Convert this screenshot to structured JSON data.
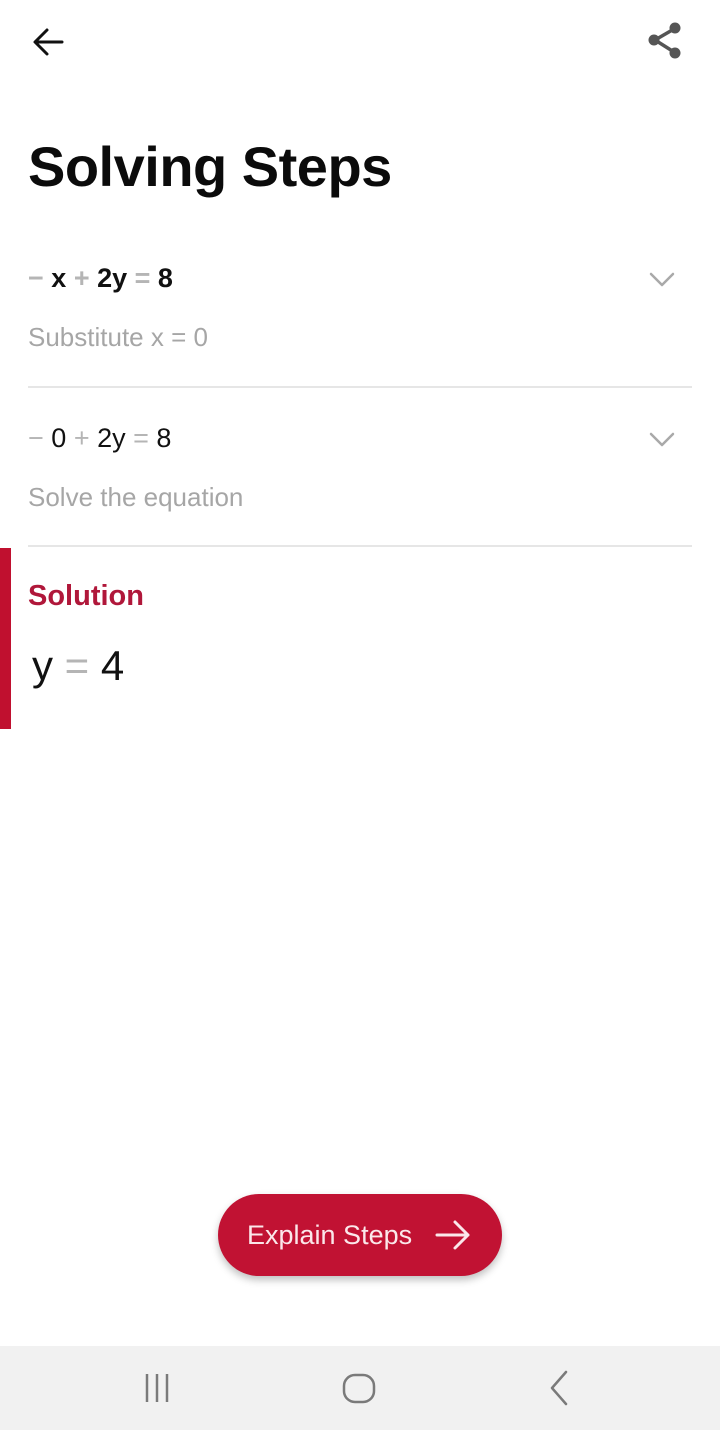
{
  "header": {
    "back_icon": "arrow-left-icon",
    "share_icon": "share-icon"
  },
  "page": {
    "title": "Solving Steps"
  },
  "steps": [
    {
      "equation_parts": [
        "−",
        " x ",
        "+",
        " 2y ",
        "=",
        " 8"
      ],
      "description": "Substitute x = 0",
      "expand_icon": "chevron-down-icon"
    },
    {
      "equation_parts": [
        "−",
        " 0 ",
        "+",
        " 2y ",
        "=",
        " 8"
      ],
      "description": "Solve the equation",
      "expand_icon": "chevron-down-icon"
    }
  ],
  "solution": {
    "label": "Solution",
    "equation_parts": [
      "y",
      " = ",
      "4"
    ]
  },
  "actions": {
    "explain_label": "Explain Steps",
    "explain_icon": "arrow-right-icon"
  },
  "colors": {
    "accent": "#c11233",
    "solution_label": "#b0173a",
    "muted_text": "#a6a6a6"
  },
  "system_nav": {
    "recents_icon": "recent-apps-icon",
    "home_icon": "home-icon",
    "back_icon": "nav-back-icon"
  }
}
